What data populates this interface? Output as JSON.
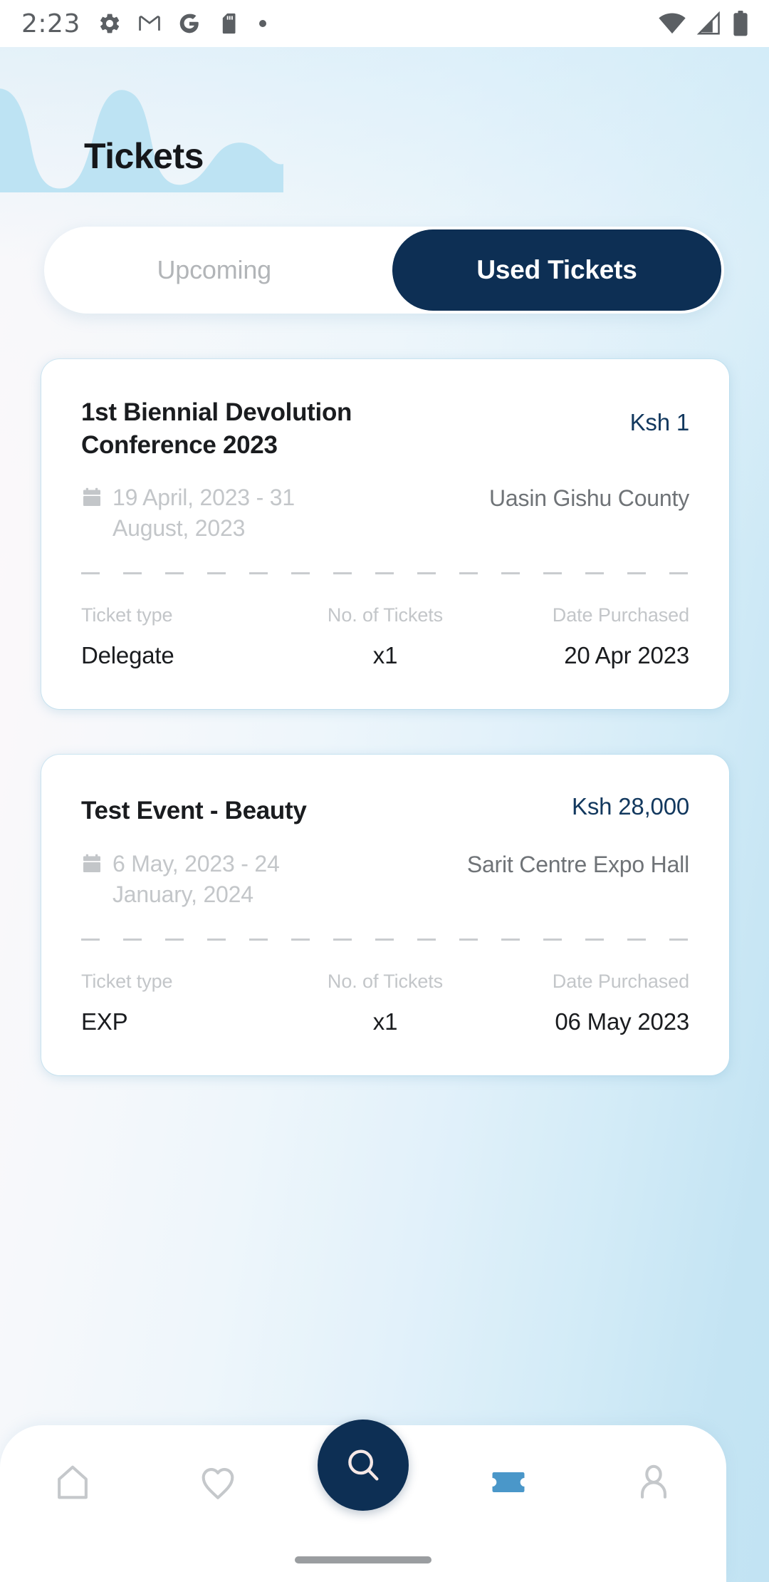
{
  "status_bar": {
    "time": "2:23",
    "left_icons": [
      "gear-icon",
      "gmail-icon",
      "google-icon",
      "sdcard-icon",
      "dot-icon"
    ],
    "right_icons": [
      "wifi-icon",
      "signal-icon",
      "battery-icon"
    ]
  },
  "header": {
    "title": "Tickets",
    "decoration": "squiggle-wave",
    "decoration_color": "#bde3f3"
  },
  "tabs": {
    "upcoming_label": "Upcoming",
    "used_label": "Used Tickets",
    "active": "Used Tickets",
    "active_bg": "#0d2f54",
    "active_text": "#ffffff",
    "inactive_text": "#b2b5b8"
  },
  "tickets": [
    {
      "title": "1st Biennial Devolution Conference 2023",
      "price": "Ksh 1",
      "date_range": "19 April, 2023 - 31 August, 2023",
      "venue": "Uasin Gishu County",
      "labels": {
        "ticket_type": "Ticket type",
        "no_of_tickets": "No. of Tickets",
        "date_purchased": "Date Purchased"
      },
      "values": {
        "ticket_type": "Delegate",
        "no_of_tickets": "x1",
        "date_purchased": "20 Apr 2023"
      }
    },
    {
      "title": "Test Event - Beauty",
      "price": "Ksh 28,000",
      "date_range": "6 May, 2023 - 24 January, 2024",
      "venue": "Sarit Centre Expo Hall",
      "labels": {
        "ticket_type": "Ticket type",
        "no_of_tickets": "No. of Tickets",
        "date_purchased": "Date Purchased"
      },
      "values": {
        "ticket_type": "EXP",
        "no_of_tickets": "x1",
        "date_purchased": "06 May 2023"
      }
    }
  ],
  "bottom_nav": {
    "items": [
      "home-icon",
      "heart-icon",
      "search-icon",
      "ticket-icon",
      "profile-icon"
    ],
    "active": "ticket-icon",
    "fab_bg": "#0d2f54",
    "active_color": "#4a97c9",
    "inactive_color": "#c5c8cb"
  },
  "colors": {
    "accent_navy": "#0d2f54",
    "accent_blue": "#4a97c9",
    "bg_light_blue": "#c2e3f3",
    "muted_text": "#c3c6c9"
  }
}
